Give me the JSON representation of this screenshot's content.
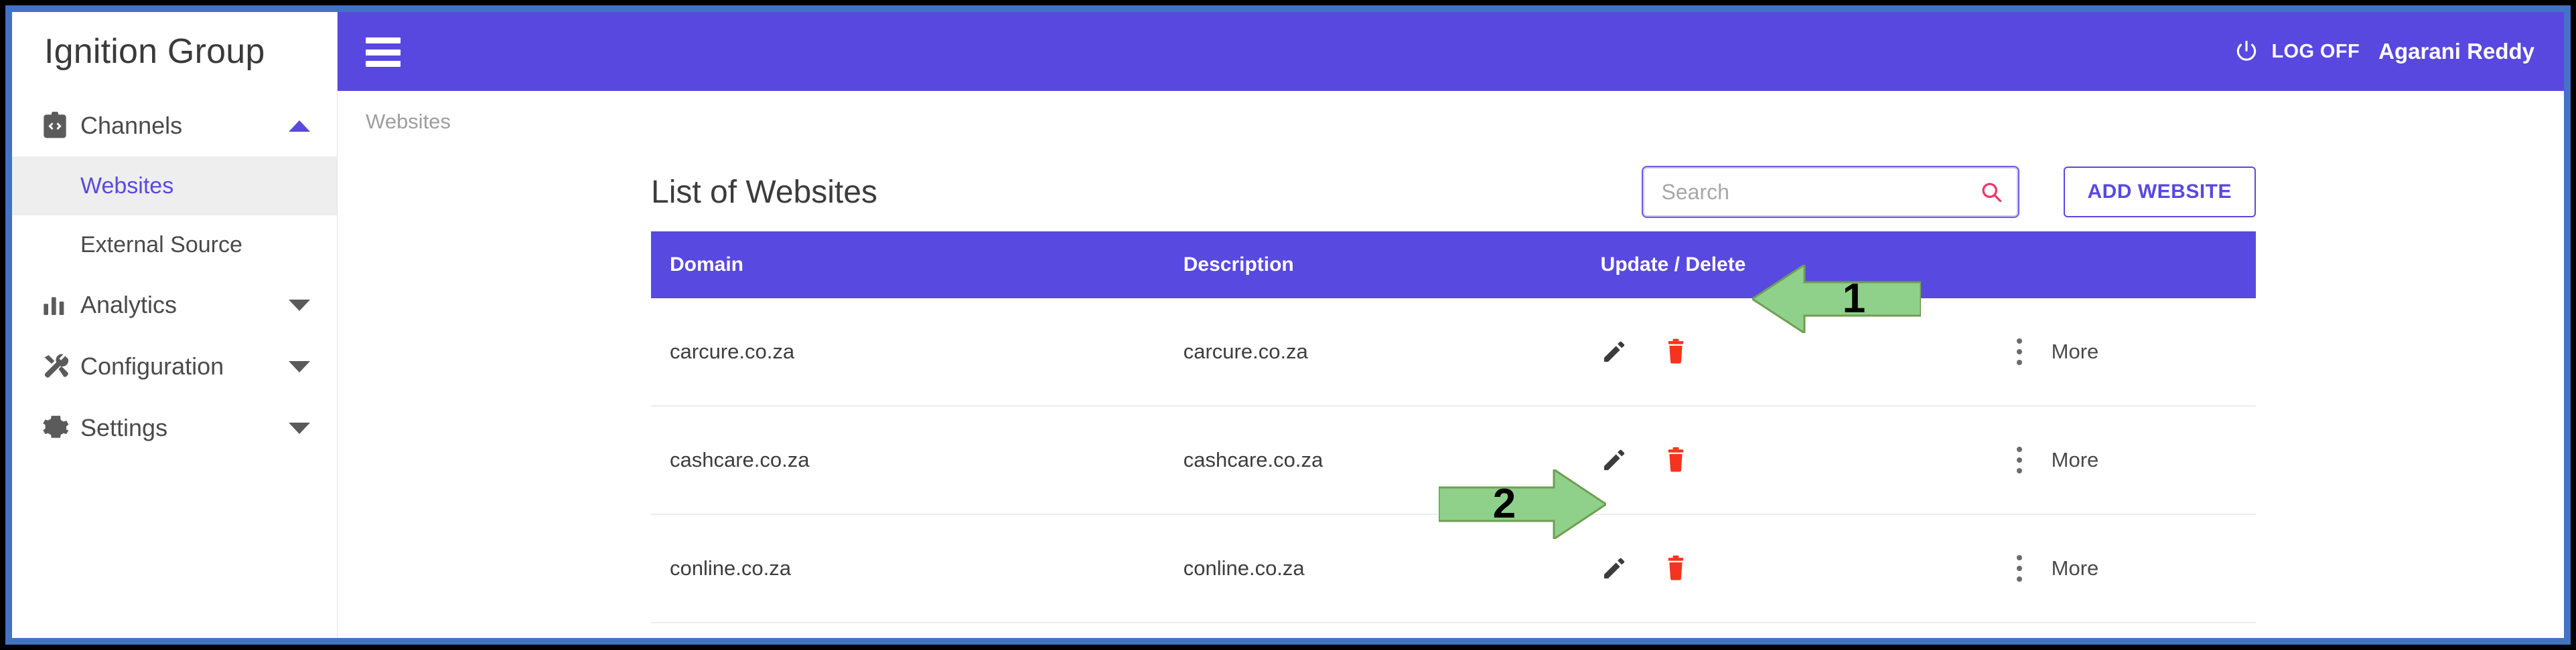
{
  "theme": {
    "accent": "#5849e0",
    "header_purple": "#5848DF",
    "frame_border": "#4472C4",
    "danger": "#f5341f",
    "search_icon": "#f0366a",
    "annotation_green": "#8fd18a"
  },
  "sidebar": {
    "brand": "Ignition Group",
    "items": [
      {
        "label": "Channels",
        "icon": "channels-icon",
        "caret": "up",
        "expanded": true
      },
      {
        "label": "Analytics",
        "icon": "analytics-icon",
        "caret": "down",
        "expanded": false
      },
      {
        "label": "Configuration",
        "icon": "configuration-icon",
        "caret": "down",
        "expanded": false
      },
      {
        "label": "Settings",
        "icon": "settings-gear-icon",
        "caret": "down",
        "expanded": false
      }
    ],
    "channels_children": [
      {
        "label": "Websites",
        "active": true
      },
      {
        "label": "External Source",
        "active": false
      }
    ]
  },
  "topbar": {
    "menu_icon": "hamburger-icon",
    "power_icon": "power-icon",
    "logoff_label": "LOG OFF",
    "username": "Agarani Reddy"
  },
  "breadcrumb": {
    "text": "Websites"
  },
  "card": {
    "title": "List of Websites",
    "search": {
      "placeholder": "Search",
      "value": "",
      "icon": "search-icon"
    },
    "add_button": "ADD WEBSITE"
  },
  "table": {
    "columns": [
      "Domain",
      "Description",
      "Update / Delete",
      ""
    ],
    "rows": [
      {
        "domain": "carcure.co.za",
        "description": "carcure.co.za",
        "more": "More"
      },
      {
        "domain": "cashcare.co.za",
        "description": "cashcare.co.za",
        "more": "More"
      },
      {
        "domain": "conline.co.za",
        "description": "conline.co.za",
        "more": "More"
      }
    ],
    "row_actions": {
      "edit": "edit-pencil-icon",
      "delete": "delete-trash-icon",
      "kebab": "more-vertical-icon"
    }
  },
  "annotations": [
    {
      "number": "1",
      "direction": "left",
      "target": "update-delete-column-header"
    },
    {
      "number": "2",
      "direction": "right",
      "target": "edit-pencil-icon-row-2"
    }
  ]
}
